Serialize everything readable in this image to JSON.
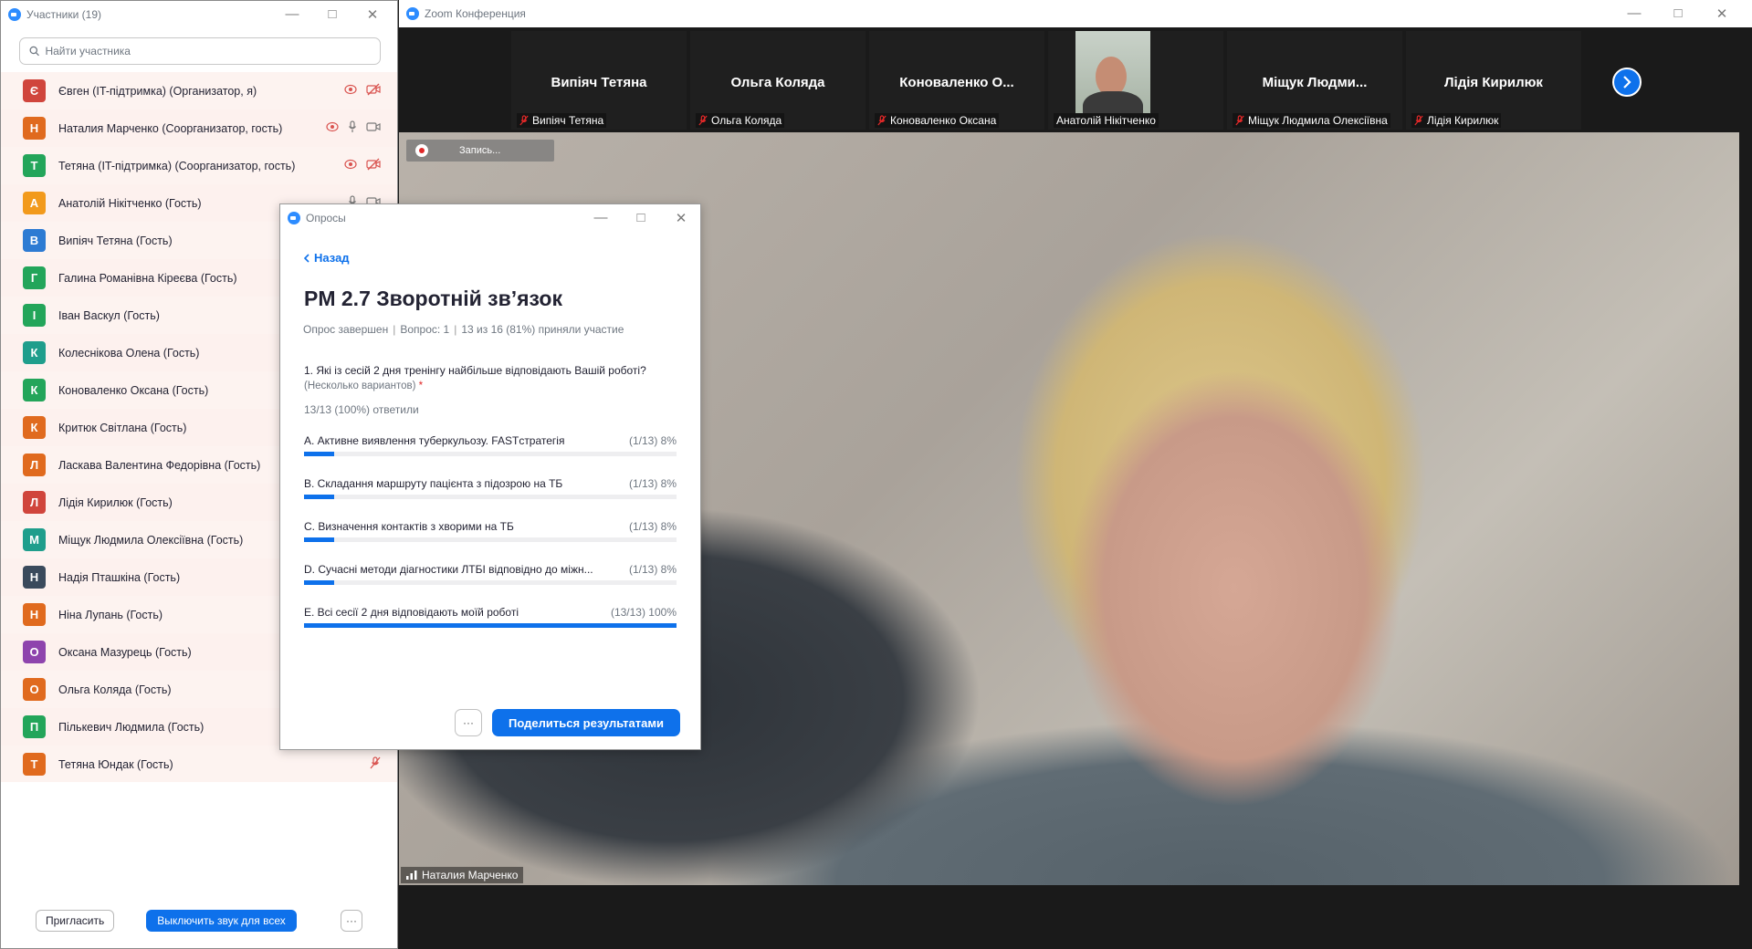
{
  "participants_window": {
    "title": "Участники (19)",
    "search_placeholder": "Найти участника",
    "participants": [
      {
        "initial": "Є",
        "color": "#d0453c",
        "name": "Євген (IT-підтримка) (Организатор, я)",
        "icons": [
          "share-icon",
          "video-off-icon"
        ]
      },
      {
        "initial": "Н",
        "color": "#e06a1e",
        "name": "Наталия Марченко (Соорганизатор, гость)",
        "icons": [
          "share-icon",
          "mic-icon",
          "video-icon"
        ]
      },
      {
        "initial": "Т",
        "color": "#23a55a",
        "name": "Тетяна (IT-підтримка) (Соорганизатор, гость)",
        "icons": [
          "share-icon",
          "video-off-icon"
        ]
      },
      {
        "initial": "А",
        "color": "#f29a1c",
        "name": "Анатолій Нікітченко (Гость)",
        "icons": [
          "mic-icon",
          "video-icon"
        ]
      },
      {
        "initial": "В",
        "color": "#2d7bd3",
        "name": "Випіяч Тетяна (Гость)",
        "icons": []
      },
      {
        "initial": "Г",
        "color": "#23a55a",
        "name": "Галина Романівна Кіреєва (Гость)",
        "icons": []
      },
      {
        "initial": "І",
        "color": "#23a55a",
        "name": "Іван Васкул (Гость)",
        "icons": []
      },
      {
        "initial": "К",
        "color": "#1f9e8c",
        "name": "Колеснікова Олена (Гость)",
        "icons": []
      },
      {
        "initial": "К",
        "color": "#23a55a",
        "name": "Коноваленко Оксана (Гость)",
        "icons": []
      },
      {
        "initial": "К",
        "color": "#e06a1e",
        "name": "Критюк Світлана (Гость)",
        "icons": []
      },
      {
        "initial": "Л",
        "color": "#e06a1e",
        "name": "Ласкава Валентина Федорівна (Гость)",
        "icons": []
      },
      {
        "initial": "Л",
        "color": "#d0453c",
        "name": "Лідія Кирилюк (Гость)",
        "icons": []
      },
      {
        "initial": "М",
        "color": "#1f9e8c",
        "name": "Міщук Людмила Олексіївна (Гость)",
        "icons": []
      },
      {
        "initial": "Н",
        "color": "#3a4a5c",
        "name": "Надія Пташкіна (Гость)",
        "icons": []
      },
      {
        "initial": "Н",
        "color": "#e06a1e",
        "name": "Ніна Лупань (Гость)",
        "icons": []
      },
      {
        "initial": "О",
        "color": "#8e44ad",
        "name": "Оксана Мазурець (Гость)",
        "icons": []
      },
      {
        "initial": "О",
        "color": "#e06a1e",
        "name": "Ольга Коляда (Гость)",
        "icons": []
      },
      {
        "initial": "П",
        "color": "#23a55a",
        "name": "Пількевич Людмила (Гость)",
        "icons": []
      },
      {
        "initial": "Т",
        "color": "#e06a1e",
        "name": "Тетяна Юндак (Гость)",
        "icons": [
          "mic-off-icon"
        ]
      }
    ],
    "invite_label": "Пригласить",
    "mute_all_label": "Выключить звук для всех",
    "more_label": "···"
  },
  "main_window": {
    "title": "Zoom Конференция",
    "thumbnails": [
      {
        "display": "Випіяч Тетяна",
        "label": "Випіяч Тетяна",
        "has_video": false
      },
      {
        "display": "Ольга Коляда",
        "label": "Ольга Коляда",
        "has_video": false
      },
      {
        "display": "Коноваленко  О...",
        "label": "Коноваленко Оксана",
        "has_video": false
      },
      {
        "display": "",
        "label": "Анатолій Нікітченко",
        "has_video": true
      },
      {
        "display": "Міщук  Людми...",
        "label": "Міщук Людмила Олексіївна",
        "has_video": false
      },
      {
        "display": "Лідія Кирилюк",
        "label": "Лідія Кирилюк",
        "has_video": false
      }
    ],
    "recording_label": "Запись...",
    "speaker_label": "Наталия Марченко"
  },
  "polls": {
    "window_title": "Опросы",
    "back_label": "Назад",
    "title": "PM 2.7 Зворотній зв’язок",
    "status": "Опрос завершен",
    "question_count": "Вопрос: 1",
    "participation": "13 из 16 (81%) приняли участие",
    "question": "1. Які із сесій 2 дня тренінгу найбільше відповідають Вашій роботі?",
    "question_hint": "(Несколько вариантов)",
    "required_mark": "*",
    "answered": "13/13 (100%) ответили",
    "options": [
      {
        "label": "A. Активне виявлення туберкульозу. FASTстратегія",
        "stat": "(1/13) 8%",
        "percent": 8
      },
      {
        "label": "B. Складання маршруту пацієнта з підозрою на ТБ",
        "stat": "(1/13) 8%",
        "percent": 8
      },
      {
        "label": "C. Визначення контактів з хворими на ТБ",
        "stat": "(1/13) 8%",
        "percent": 8
      },
      {
        "label": "D. Сучасні методи діагностики ЛТБІ відповідно до міжн...",
        "stat": "(1/13) 8%",
        "percent": 8
      },
      {
        "label": "E. Всі сесії 2 дня відповідають моїй роботі",
        "stat": "(13/13) 100%",
        "percent": 100
      }
    ],
    "more_label": "···",
    "share_label": "Поделиться результатами"
  },
  "colors": {
    "accent": "#0e71eb",
    "muted_red": "#e02828",
    "row_highlight": "#fdf1ee"
  }
}
